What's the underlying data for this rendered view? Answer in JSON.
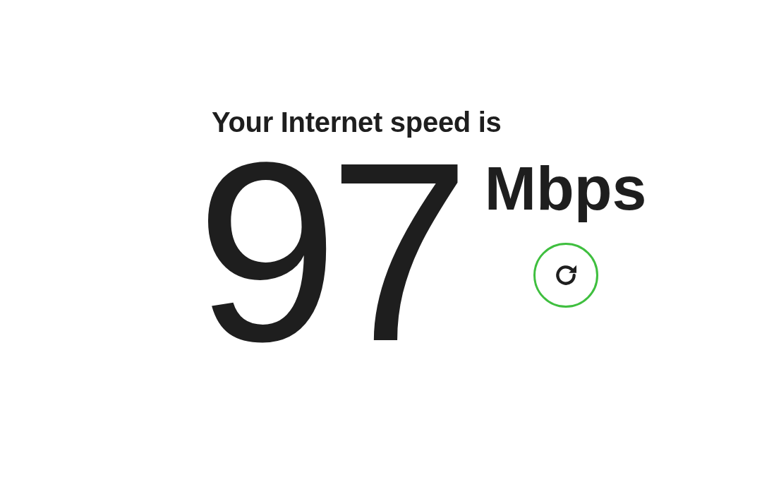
{
  "heading": "Your Internet speed is",
  "speed": {
    "value": "97",
    "unit": "Mbps"
  }
}
